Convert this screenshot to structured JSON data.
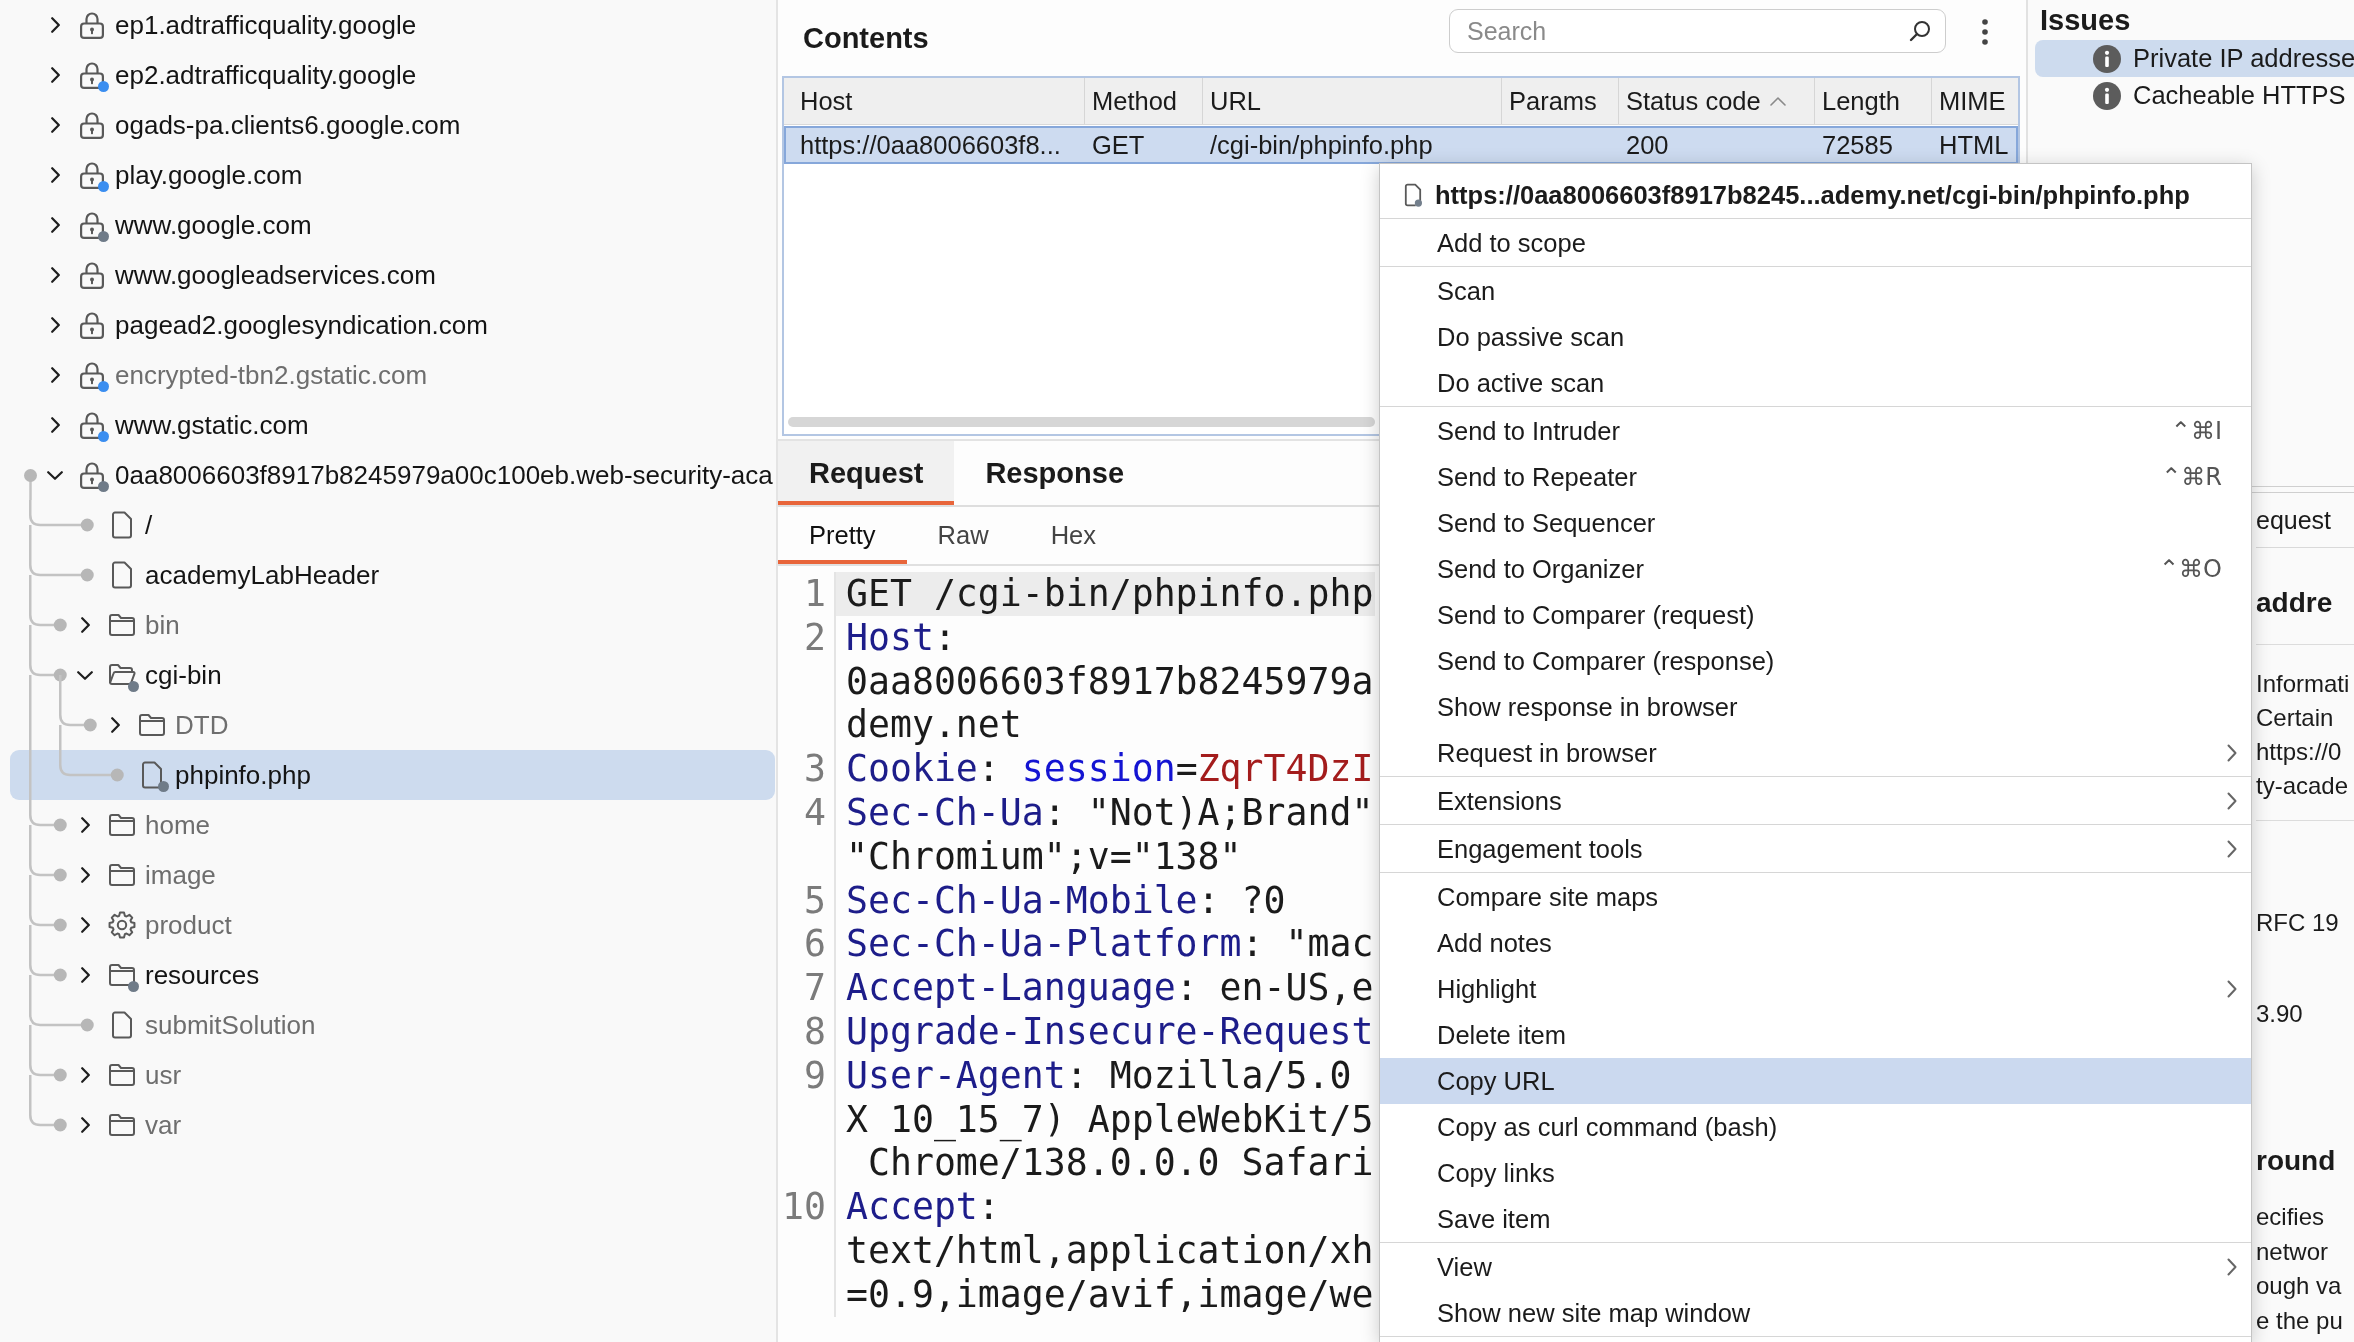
{
  "site_map": {
    "items": [
      {
        "label": "ep1.adtrafficquality.google",
        "kind": "host",
        "expanded": false,
        "selected": false,
        "dimmed": false
      },
      {
        "label": "ep2.adtrafficquality.google",
        "kind": "host",
        "expanded": false,
        "selected": false,
        "dimmed": false,
        "color": "#3b8ef0"
      },
      {
        "label": "ogads-pa.clients6.google.com",
        "kind": "host",
        "expanded": false,
        "selected": false,
        "dimmed": false
      },
      {
        "label": "play.google.com",
        "kind": "host",
        "expanded": false,
        "selected": false,
        "dimmed": false,
        "color": "#3b8ef0"
      },
      {
        "label": "www.google.com",
        "kind": "host",
        "expanded": false,
        "selected": false,
        "dimmed": false,
        "color": "#6f7b88"
      },
      {
        "label": "www.googleadservices.com",
        "kind": "host",
        "expanded": false,
        "selected": false,
        "dimmed": false
      },
      {
        "label": "pagead2.googlesyndication.com",
        "kind": "host",
        "expanded": false,
        "selected": false,
        "dimmed": false
      },
      {
        "label": "encrypted-tbn2.gstatic.com",
        "kind": "host",
        "expanded": false,
        "selected": false,
        "dimmed": true,
        "color": "#3b8ef0"
      },
      {
        "label": "www.gstatic.com",
        "kind": "host",
        "expanded": false,
        "selected": false,
        "dimmed": false,
        "color": "#3b8ef0"
      },
      {
        "label": "0aa8006603f8917b8245979a00c100eb.web-security-aca",
        "kind": "host",
        "expanded": true,
        "selected": false,
        "dimmed": false,
        "color": "#6f7b88",
        "children": [
          {
            "label": "/",
            "kind": "file",
            "selected": false,
            "dimmed": false
          },
          {
            "label": "academyLabHeader",
            "kind": "file",
            "selected": false,
            "dimmed": false
          },
          {
            "label": "bin",
            "kind": "folder",
            "expanded": false,
            "selected": false,
            "dimmed": true
          },
          {
            "label": "cgi-bin",
            "kind": "folder",
            "expanded": true,
            "selected": false,
            "dimmed": false,
            "color": "#6f7b88",
            "children": [
              {
                "label": "DTD",
                "kind": "folder",
                "expanded": false,
                "selected": false,
                "dimmed": true
              },
              {
                "label": "phpinfo.php",
                "kind": "file",
                "selected": true,
                "dimmed": false,
                "color": "#6f7b88"
              }
            ]
          },
          {
            "label": "home",
            "kind": "folder",
            "expanded": false,
            "selected": false,
            "dimmed": true
          },
          {
            "label": "image",
            "kind": "folder",
            "expanded": false,
            "selected": false,
            "dimmed": true
          },
          {
            "label": "product",
            "kind": "dynamic",
            "expanded": false,
            "selected": false,
            "dimmed": true
          },
          {
            "label": "resources",
            "kind": "folder",
            "expanded": false,
            "selected": false,
            "dimmed": false,
            "color": "#6f7b88"
          },
          {
            "label": "submitSolution",
            "kind": "file",
            "selected": false,
            "dimmed": true
          },
          {
            "label": "usr",
            "kind": "folder",
            "expanded": false,
            "selected": false,
            "dimmed": true
          },
          {
            "label": "var",
            "kind": "folder",
            "expanded": false,
            "selected": false,
            "dimmed": true
          }
        ]
      }
    ]
  },
  "contents": {
    "title": "Contents",
    "search": {
      "placeholder": "Search"
    },
    "columns": [
      {
        "label": "Host",
        "sorted": false
      },
      {
        "label": "Method",
        "sorted": false
      },
      {
        "label": "URL",
        "sorted": false
      },
      {
        "label": "Params",
        "sorted": false
      },
      {
        "label": "Status code",
        "sorted": true
      },
      {
        "label": "Length",
        "sorted": false
      },
      {
        "label": "MIME",
        "sorted": false
      }
    ],
    "rows": [
      {
        "host": "https://0aa8006603f8...",
        "method": "GET",
        "url": "/cgi-bin/phpinfo.php",
        "status_code": "200",
        "length": "72585",
        "mime": "HTML",
        "selected": true
      }
    ]
  },
  "request_pane": {
    "tabs": [
      {
        "label": "Request",
        "selected": true
      },
      {
        "label": "Response",
        "selected": false
      }
    ],
    "view_tabs": [
      {
        "label": "Pretty",
        "selected": true
      },
      {
        "label": "Raw",
        "selected": false
      },
      {
        "label": "Hex",
        "selected": false
      }
    ],
    "lines": [
      {
        "number": "1",
        "current": true,
        "rows": [
          [
            {
              "kind": "plain",
              "text": "GET /cgi-bin/phpinfo.php"
            }
          ]
        ]
      },
      {
        "number": "2",
        "current": false,
        "rows": [
          [
            {
              "kind": "header",
              "text": "Host"
            },
            {
              "kind": "plain",
              "text": ":"
            }
          ],
          [
            {
              "kind": "plain",
              "text": "0aa8006603f8917b8245979a"
            }
          ],
          [
            {
              "kind": "plain",
              "text": "demy.net"
            }
          ]
        ]
      },
      {
        "number": "3",
        "current": false,
        "rows": [
          [
            {
              "kind": "header",
              "text": "Cookie"
            },
            {
              "kind": "plain",
              "text": ": "
            },
            {
              "kind": "param",
              "text": "session"
            },
            {
              "kind": "plain",
              "text": "="
            },
            {
              "kind": "value",
              "text": "ZqrT4DzI"
            }
          ]
        ]
      },
      {
        "number": "4",
        "current": false,
        "rows": [
          [
            {
              "kind": "header",
              "text": "Sec-Ch-Ua"
            },
            {
              "kind": "plain",
              "text": ": \"Not)A;Brand\""
            }
          ],
          [
            {
              "kind": "plain",
              "text": "\"Chromium\";v=\"138\""
            }
          ]
        ]
      },
      {
        "number": "5",
        "current": false,
        "rows": [
          [
            {
              "kind": "header",
              "text": "Sec-Ch-Ua-Mobile"
            },
            {
              "kind": "plain",
              "text": ": ?0"
            }
          ]
        ]
      },
      {
        "number": "6",
        "current": false,
        "rows": [
          [
            {
              "kind": "header",
              "text": "Sec-Ch-Ua-Platform"
            },
            {
              "kind": "plain",
              "text": ": \"mac"
            }
          ]
        ]
      },
      {
        "number": "7",
        "current": false,
        "rows": [
          [
            {
              "kind": "header",
              "text": "Accept-Language"
            },
            {
              "kind": "plain",
              "text": ": en-US,e"
            }
          ]
        ]
      },
      {
        "number": "8",
        "current": false,
        "rows": [
          [
            {
              "kind": "header",
              "text": "Upgrade-Insecure-Request"
            }
          ]
        ]
      },
      {
        "number": "9",
        "current": false,
        "rows": [
          [
            {
              "kind": "header",
              "text": "User-Agent"
            },
            {
              "kind": "plain",
              "text": ": Mozilla/5.0"
            }
          ],
          [
            {
              "kind": "plain",
              "text": "X 10_15_7) AppleWebKit/5"
            }
          ],
          [
            {
              "kind": "plain",
              "text": " Chrome/138.0.0.0 Safari"
            }
          ]
        ]
      },
      {
        "number": "10",
        "current": false,
        "rows": [
          [
            {
              "kind": "header",
              "text": "Accept"
            },
            {
              "kind": "plain",
              "text": ":"
            }
          ],
          [
            {
              "kind": "plain",
              "text": "text/html,application/xh"
            }
          ],
          [
            {
              "kind": "plain",
              "text": "=0.9,image/avif,image/we"
            }
          ]
        ]
      }
    ]
  },
  "issues_panel": {
    "title": "Issues",
    "items": [
      {
        "label": "Private IP addresse",
        "selected": true
      },
      {
        "label": "Cacheable HTTPS",
        "selected": false
      }
    ]
  },
  "issue_detail": {
    "tab": "equest",
    "heading": "addre",
    "fields": [
      "Informati",
      "Certain",
      "https://0",
      "ty-acade"
    ],
    "lines": [
      "RFC 19",
      "3.90"
    ],
    "section_heading": "round",
    "paragraph": [
      "ecifies",
      "networ",
      "ough va",
      "e the pu"
    ]
  },
  "context_menu": {
    "title": "https://0aa8006603f8917b8245...ademy.net/cgi-bin/phpinfo.php",
    "groups": [
      [
        {
          "label": "Add to scope",
          "submenu": false,
          "selected": false
        }
      ],
      [
        {
          "label": "Scan",
          "submenu": false,
          "selected": false
        },
        {
          "label": "Do passive scan",
          "submenu": false,
          "selected": false
        },
        {
          "label": "Do active scan",
          "submenu": false,
          "selected": false
        }
      ],
      [
        {
          "label": "Send to Intruder",
          "shortcut": "⌃⌘I",
          "submenu": false,
          "selected": false
        },
        {
          "label": "Send to Repeater",
          "shortcut": "⌃⌘R",
          "submenu": false,
          "selected": false
        },
        {
          "label": "Send to Sequencer",
          "submenu": false,
          "selected": false
        },
        {
          "label": "Send to Organizer",
          "shortcut": "⌃⌘O",
          "submenu": false,
          "selected": false
        },
        {
          "label": "Send to Comparer (request)",
          "submenu": false,
          "selected": false
        },
        {
          "label": "Send to Comparer (response)",
          "submenu": false,
          "selected": false
        },
        {
          "label": "Show response in browser",
          "submenu": false,
          "selected": false
        },
        {
          "label": "Request in browser",
          "submenu": true,
          "selected": false
        }
      ],
      [
        {
          "label": "Extensions",
          "submenu": true,
          "selected": false
        }
      ],
      [
        {
          "label": "Engagement tools",
          "submenu": true,
          "selected": false
        }
      ],
      [
        {
          "label": "Compare site maps",
          "submenu": false,
          "selected": false
        },
        {
          "label": "Add notes",
          "submenu": false,
          "selected": false
        },
        {
          "label": "Highlight",
          "submenu": true,
          "selected": false
        },
        {
          "label": "Delete item",
          "submenu": false,
          "selected": false
        },
        {
          "label": "Copy URL",
          "submenu": false,
          "selected": true
        },
        {
          "label": "Copy as curl command (bash)",
          "submenu": false,
          "selected": false
        },
        {
          "label": "Copy links",
          "submenu": false,
          "selected": false
        },
        {
          "label": "Save item",
          "submenu": false,
          "selected": false
        }
      ],
      [
        {
          "label": "View",
          "submenu": true,
          "selected": false
        },
        {
          "label": "Show new site map window",
          "submenu": false,
          "selected": false
        }
      ]
    ]
  }
}
